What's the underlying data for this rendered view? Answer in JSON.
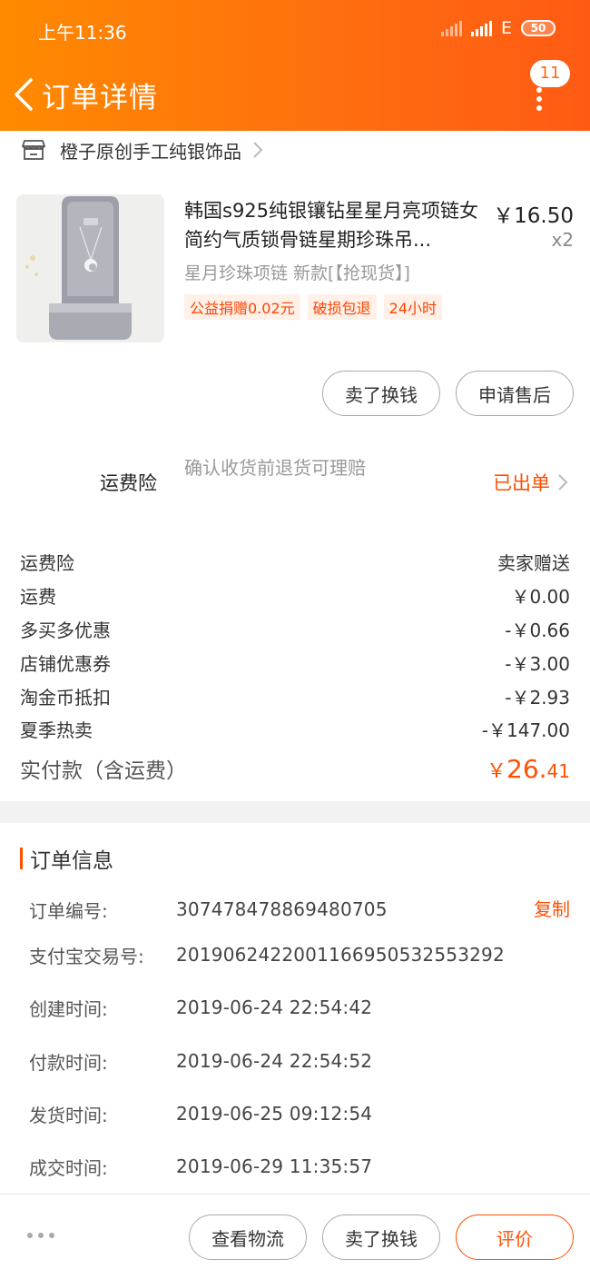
{
  "status_bar": {
    "time": "上午11:36",
    "network": "E",
    "battery": "50"
  },
  "nav": {
    "title": "订单详情",
    "badge": "11"
  },
  "shop": {
    "name": "橙子原创手工纯银饰品"
  },
  "product": {
    "title": "韩国s925纯银镶钻星星月亮项链女简约气质锁骨链星期珍珠吊...",
    "price": "￥16.50",
    "qty": "x2",
    "sku": "星月珍珠项链 新款[【抢现货】]",
    "tags": [
      "公益捐赠0.02元",
      "破损包退",
      "24小时"
    ]
  },
  "product_actions": {
    "sell_label": "卖了换钱",
    "after_sale_label": "申请售后"
  },
  "insurance": {
    "label": "运费险",
    "desc": "确认收货前退货可理赔",
    "status": "已出单"
  },
  "fees": [
    {
      "label": "运费险",
      "value": "卖家赠送"
    },
    {
      "label": "运费",
      "value": "￥0.00"
    },
    {
      "label": "多买多优惠",
      "value": "-￥0.66"
    },
    {
      "label": "店铺优惠券",
      "value": "-￥3.00"
    },
    {
      "label": "淘金币抵扣",
      "value": "-￥2.93"
    },
    {
      "label": "夏季热卖",
      "value": "-￥147.00"
    }
  ],
  "total": {
    "label": "实付款（含运费）",
    "currency": "￥",
    "integer": "26.",
    "decimal": "41"
  },
  "order_info": {
    "title": "订单信息",
    "copy_label": "复制",
    "rows": [
      {
        "key": "订单编号:",
        "value": "307478478869480705"
      },
      {
        "key": "支付宝交易号:",
        "value": "2019062422001166950532553292"
      },
      {
        "key": "创建时间:",
        "value": "2019-06-24 22:54:42"
      },
      {
        "key": "付款时间:",
        "value": "2019-06-24 22:54:52"
      },
      {
        "key": "发货时间:",
        "value": "2019-06-25 09:12:54"
      },
      {
        "key": "成交时间:",
        "value": "2019-06-29 11:35:57"
      }
    ]
  },
  "bottom_bar": {
    "logistics_label": "查看物流",
    "sell_label": "卖了换钱",
    "review_label": "评价"
  },
  "colors": {
    "accent": "#ff5000",
    "header_start": "#ff8a00",
    "header_end": "#ff5a14"
  }
}
